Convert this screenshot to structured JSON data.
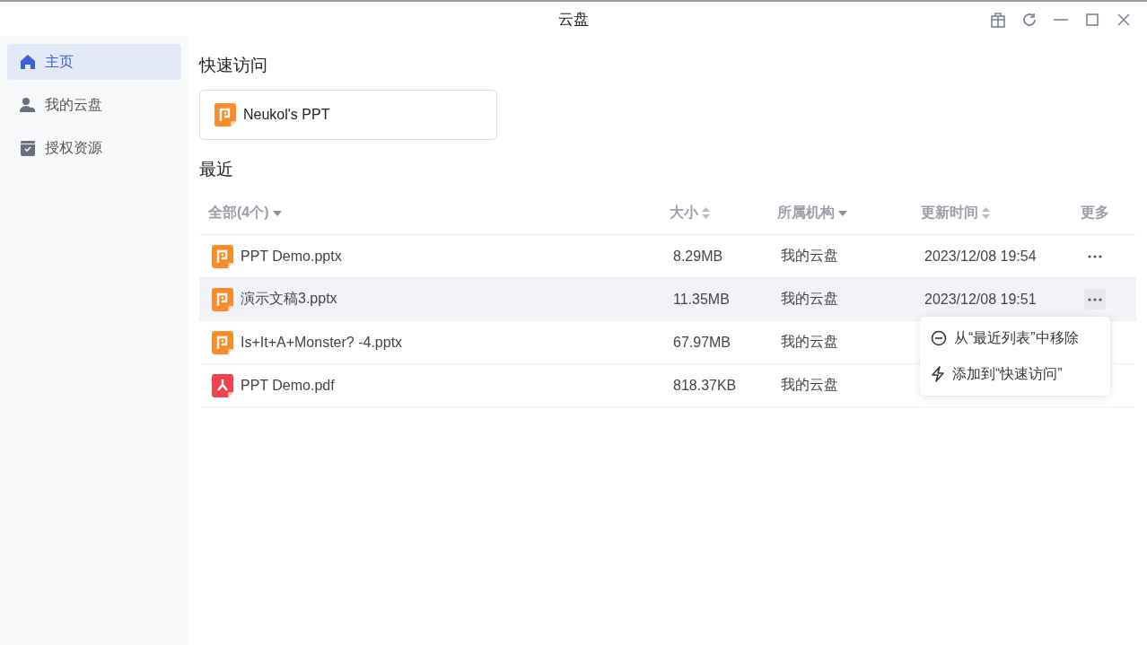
{
  "window": {
    "title": "云盘"
  },
  "sidebar": {
    "items": [
      {
        "label": "主页",
        "selected": true
      },
      {
        "label": "我的云盘",
        "selected": false
      },
      {
        "label": "授权资源",
        "selected": false
      }
    ]
  },
  "quick_access": {
    "title": "快速访问",
    "items": [
      {
        "name": "Neukol's PPT",
        "kind": "pptx"
      }
    ]
  },
  "recent": {
    "title": "最近",
    "columns": [
      {
        "label": "全部(4个)",
        "kind": "filter"
      },
      {
        "label": "大小",
        "kind": "sort"
      },
      {
        "label": "所属机构",
        "kind": "filter"
      },
      {
        "label": "更新时间",
        "kind": "sort"
      },
      {
        "label": "更多",
        "kind": "plain"
      }
    ],
    "rows": [
      {
        "name": "PPT Demo.pptx",
        "kind": "pptx",
        "size": "8.29MB",
        "org": "我的云盘",
        "time": "2023/12/08 19:54",
        "selected": false
      },
      {
        "name": "演示文稿3.pptx",
        "kind": "pptx",
        "size": "11.35MB",
        "org": "我的云盘",
        "time": "2023/12/08 19:51",
        "selected": true
      },
      {
        "name": "Is+It+A+Monster?  -4.pptx",
        "kind": "pptx",
        "size": "67.97MB",
        "org": "我的云盘",
        "selected": false
      },
      {
        "name": "PPT Demo.pdf",
        "kind": "pdf",
        "size": "818.37KB",
        "org": "我的云盘",
        "selected": false
      }
    ]
  },
  "context_menu": {
    "items": [
      {
        "label": "从“最近列表”中移除"
      },
      {
        "label": "添加到“快速访问”"
      }
    ]
  }
}
